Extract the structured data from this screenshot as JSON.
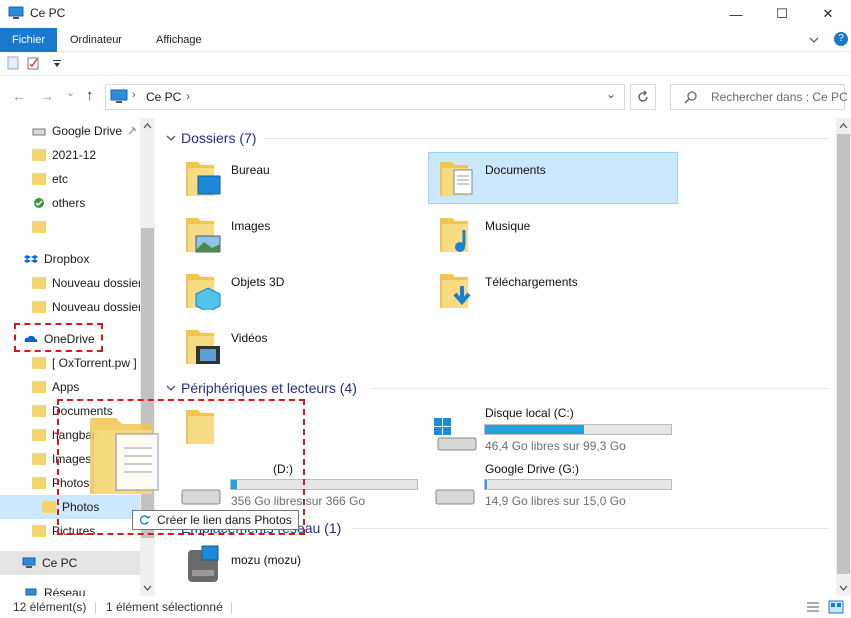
{
  "window": {
    "title": "Ce PC",
    "minimize": "—",
    "maximize": "☐",
    "close": "✕"
  },
  "ribbon": {
    "tabs": [
      "Fichier",
      "Ordinateur",
      "Affichage"
    ],
    "expand_icon": "chevron-down-icon",
    "help": "?"
  },
  "navigation": {
    "back": "←",
    "forward": "→",
    "recent": "⌄",
    "up": "↑",
    "address": "Ce PC",
    "address_chevron": "›",
    "dropdown": "⌄",
    "search_placeholder": "Rechercher dans : Ce PC"
  },
  "nav_pane": {
    "items": [
      {
        "label": "Google Drive",
        "icon": "drive-icon"
      },
      {
        "label": "2021-12",
        "icon": "folder-icon"
      },
      {
        "label": "etc",
        "icon": "folder-icon"
      },
      {
        "label": "others",
        "icon": "synced-folder-icon"
      },
      {
        "label": "",
        "icon": "folder-icon"
      },
      {
        "label": "Dropbox",
        "icon": "dropbox-icon"
      },
      {
        "label": "Nouveau dossier",
        "icon": "folder-icon"
      },
      {
        "label": "Nouveau dossier",
        "icon": "folder-icon"
      },
      {
        "label": "OneDrive",
        "icon": "onedrive-icon"
      },
      {
        "label": "[ OxTorrent.pw ]",
        "icon": "folder-icon"
      },
      {
        "label": "Apps",
        "icon": "folder-icon"
      },
      {
        "label": "Documents",
        "icon": "folder-icon"
      },
      {
        "label": "hangbao",
        "icon": "folder-icon"
      },
      {
        "label": "Images",
        "icon": "folder-icon"
      },
      {
        "label": "Photos",
        "icon": "folder-icon"
      },
      {
        "label": "Photos",
        "icon": "folder-icon"
      },
      {
        "label": "Pictures",
        "icon": "folder-icon"
      },
      {
        "label": "Ce PC",
        "icon": "computer-icon"
      },
      {
        "label": "Réseau",
        "icon": "network-icon"
      }
    ]
  },
  "groups": {
    "folders": {
      "header": "Dossiers (7)",
      "items": [
        "Bureau",
        "Documents",
        "Images",
        "Musique",
        "Objets 3D",
        "Téléchargements",
        "Vidéos"
      ]
    },
    "devices": {
      "header": "Périphériques et lecteurs (4)",
      "items": [
        {
          "name": "",
          "free": ""
        },
        {
          "name": "Disque local (C:)",
          "free": "46,4 Go libres sur 99,3 Go",
          "usage": 0.53
        },
        {
          "name": "(D:)",
          "free": "356 Go libres sur 366 Go",
          "usage": 0.03
        },
        {
          "name": "Google Drive (G:)",
          "free": "14,9 Go libres sur 15,0 Go",
          "usage": 0.01
        }
      ]
    },
    "network": {
      "header": "Emplacements réseau (1)",
      "items": [
        "mozu (mozu)"
      ]
    }
  },
  "drag": {
    "tooltip": "Créer le lien dans Photos",
    "tooltip_icon": "link-icon"
  },
  "status": {
    "count": "12 élément(s)",
    "selected": "1 élément sélectionné"
  },
  "colors": {
    "accent": "#1979ca",
    "selection": "#cce8ff",
    "drive_bar": "#26a0da",
    "highlight": "#d61a1a",
    "folder": "#f5d46b"
  }
}
